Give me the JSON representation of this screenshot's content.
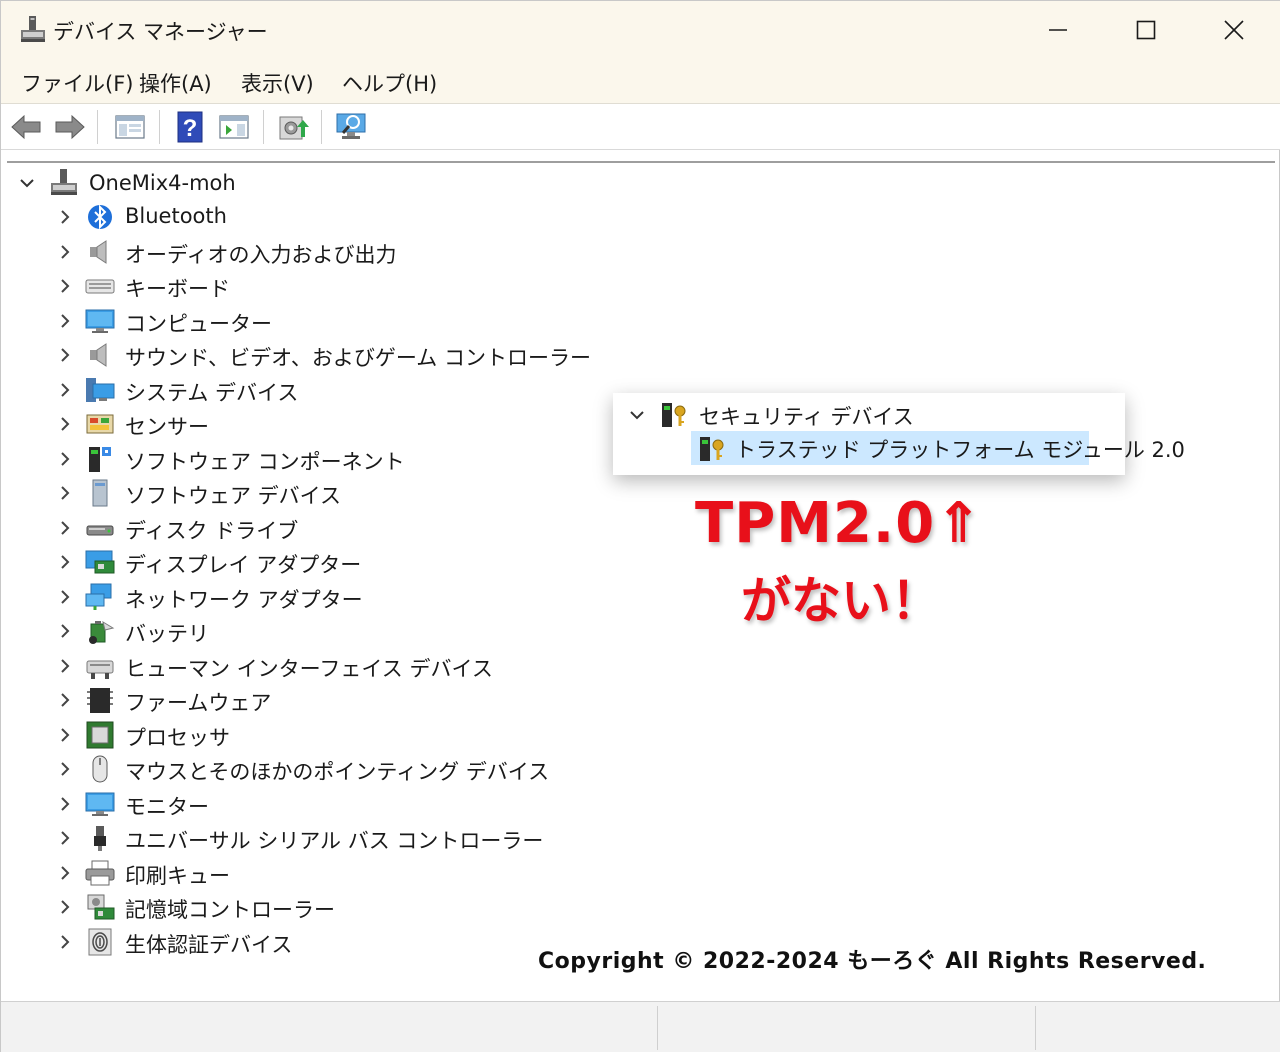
{
  "window": {
    "title": "デバイス マネージャー"
  },
  "menu": [
    {
      "label": "ファイル(F)"
    },
    {
      "label": "操作(A)"
    },
    {
      "label": "表示(V)"
    },
    {
      "label": "ヘルプ(H)"
    }
  ],
  "toolbar": [
    {
      "icon": "back-arrow-icon"
    },
    {
      "icon": "forward-arrow-icon"
    },
    {
      "icon": "show-hide-console-tree-icon"
    },
    {
      "icon": "help-icon"
    },
    {
      "icon": "action-pane-icon"
    },
    {
      "icon": "update-driver-icon"
    },
    {
      "icon": "scan-hardware-changes-icon"
    }
  ],
  "tree": {
    "root": {
      "label": "OneMix4-moh",
      "expanded": true
    },
    "categories": [
      {
        "label": "Bluetooth",
        "icon": "bluetooth-icon"
      },
      {
        "label": "オーディオの入力および出力",
        "icon": "speaker-icon"
      },
      {
        "label": "キーボード",
        "icon": "keyboard-icon"
      },
      {
        "label": "コンピューター",
        "icon": "monitor-icon"
      },
      {
        "label": "サウンド、ビデオ、およびゲーム コントローラー",
        "icon": "speaker-icon"
      },
      {
        "label": "システム デバイス",
        "icon": "system-device-icon"
      },
      {
        "label": "センサー",
        "icon": "sensor-icon"
      },
      {
        "label": "ソフトウェア コンポーネント",
        "icon": "software-component-icon"
      },
      {
        "label": "ソフトウェア デバイス",
        "icon": "software-device-icon"
      },
      {
        "label": "ディスク ドライブ",
        "icon": "disk-drive-icon"
      },
      {
        "label": "ディスプレイ アダプター",
        "icon": "display-adapter-icon"
      },
      {
        "label": "ネットワーク アダプター",
        "icon": "network-adapter-icon"
      },
      {
        "label": "バッテリ",
        "icon": "battery-icon"
      },
      {
        "label": "ヒューマン インターフェイス デバイス",
        "icon": "hid-icon"
      },
      {
        "label": "ファームウェア",
        "icon": "firmware-icon"
      },
      {
        "label": "プロセッサ",
        "icon": "processor-icon"
      },
      {
        "label": "マウスとそのほかのポインティング デバイス",
        "icon": "mouse-icon"
      },
      {
        "label": "モニター",
        "icon": "monitor-icon"
      },
      {
        "label": "ユニバーサル シリアル バス コントローラー",
        "icon": "usb-icon"
      },
      {
        "label": "印刷キュー",
        "icon": "printer-icon"
      },
      {
        "label": "記憶域コントローラー",
        "icon": "storage-controller-icon"
      },
      {
        "label": "生体認証デバイス",
        "icon": "fingerprint-icon"
      }
    ]
  },
  "popup": {
    "category": "セキュリティ デバイス",
    "child": "トラステッド プラットフォーム モジュール 2.0"
  },
  "annotation": {
    "line1": "TPM2.0⇑",
    "line2": "がない！",
    "color": "#e8101a"
  },
  "copyright": "Copyright © 2022-2024 もーろぐ All Rights Reserved."
}
